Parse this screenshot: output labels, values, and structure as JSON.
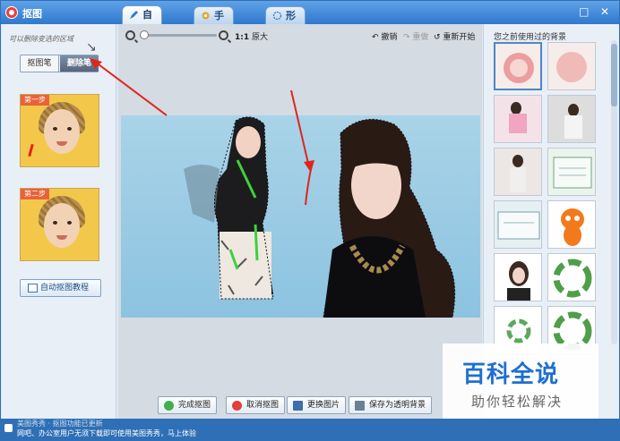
{
  "window": {
    "title": "抠图"
  },
  "tabs": [
    {
      "label": "自动抠图",
      "active": true,
      "icon": "pen-icon"
    },
    {
      "label": "手动抠图",
      "active": false,
      "icon": "gear-icon"
    },
    {
      "label": "形状抠图",
      "active": false,
      "icon": "shape-icon"
    }
  ],
  "left_panel": {
    "hint": "可以删除变选的区域",
    "mode_buttons": [
      "抠图笔",
      "删除笔"
    ],
    "selected_mode": "删除笔",
    "steps": [
      "第一步",
      "第二步"
    ],
    "tutorial_button": "自动抠图教程"
  },
  "toolbar": {
    "ratio": "1:1",
    "ratio_label": "原大",
    "undo": "撤销",
    "redo": "重做",
    "restart": "重新开始"
  },
  "right_panel": {
    "title": "您之前使用过的背景"
  },
  "actions": {
    "done": "完成抠图",
    "cancel": "取消抠图",
    "replace": "更换图片",
    "save": "保存为透明背景"
  },
  "status": {
    "line1": "美图秀秀 · 抠图功能已更新",
    "line2": "网吧、办公室用户无须下载即可使用美图秀秀，马上体验"
  },
  "watermark": {
    "title": "百科全说",
    "subtitle": "助你轻松解决"
  },
  "colors": {
    "accent": "#2f78cf",
    "highlight_arrow": "#e0251c"
  }
}
